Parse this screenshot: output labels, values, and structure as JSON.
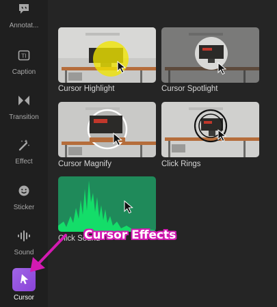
{
  "sidebar": {
    "items": [
      {
        "label": "Annotat...",
        "icon": "comment-icon"
      },
      {
        "label": "Caption",
        "icon": "caption-icon"
      },
      {
        "label": "Transition",
        "icon": "transition-icon"
      },
      {
        "label": "Effect",
        "icon": "magic-wand-icon"
      },
      {
        "label": "Sticker",
        "icon": "sticker-icon"
      },
      {
        "label": "Sound",
        "icon": "sound-wave-icon"
      },
      {
        "label": "Cursor",
        "icon": "cursor-icon",
        "active": true
      }
    ]
  },
  "effects": [
    {
      "label": "Cursor Highlight"
    },
    {
      "label": "Cursor Spotlight"
    },
    {
      "label": "Cursor Magnify"
    },
    {
      "label": "Click Rings"
    },
    {
      "label": "Click Sound"
    }
  ],
  "annotation": {
    "callout_text": "Cursor Effects",
    "color": "#d31ab2"
  },
  "colors": {
    "accent": "#9b59e0",
    "background": "#252525",
    "sidebar": "#1f1f1f",
    "sound_tile": "#1f8a5a"
  }
}
